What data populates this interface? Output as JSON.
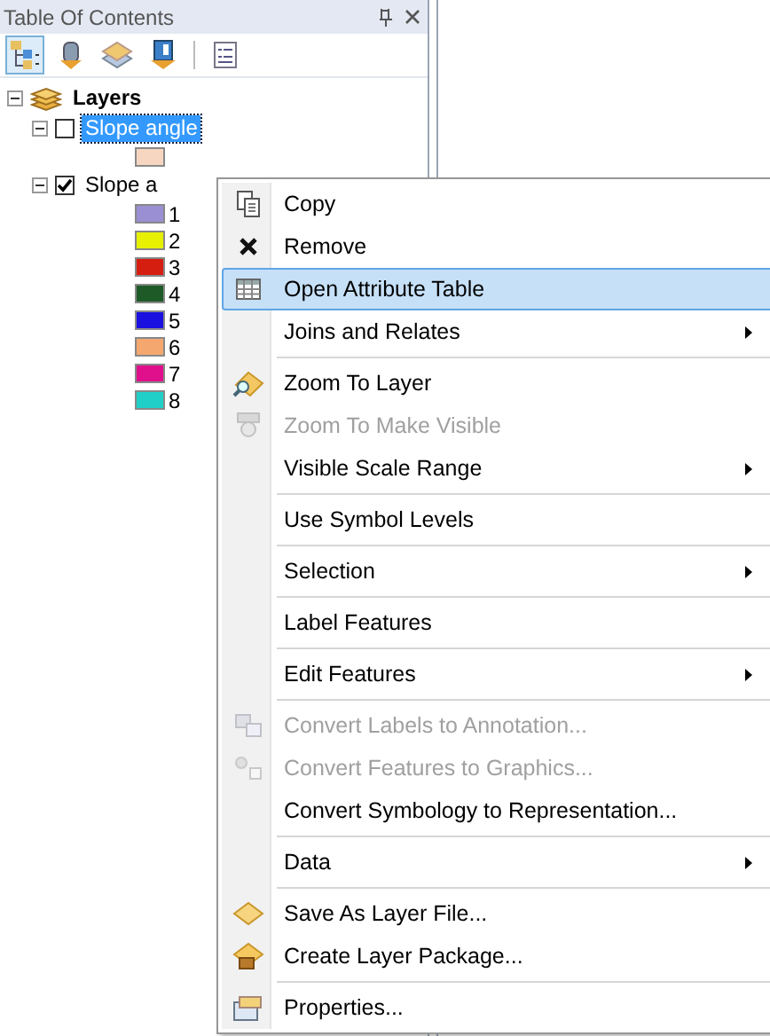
{
  "panel": {
    "title": "Table Of Contents"
  },
  "toolbar": [
    {
      "selected": true
    },
    {
      "selected": false
    },
    {
      "selected": false
    },
    {
      "selected": false
    },
    {
      "selected": false
    }
  ],
  "tree": {
    "label": "Layers",
    "expanded": true,
    "children": [
      {
        "label": "Slope angle",
        "checked": false,
        "selected": true,
        "expanded": true,
        "legend": [
          {
            "color": "#f6d6c0"
          }
        ]
      },
      {
        "label": "Slope a",
        "checked": true,
        "selected": false,
        "expanded": true,
        "legend": [
          {
            "label": "1",
            "color": "#9b8fd4"
          },
          {
            "label": "2",
            "color": "#e6f000"
          },
          {
            "label": "3",
            "color": "#d61e10"
          },
          {
            "label": "4",
            "color": "#1d5a28"
          },
          {
            "label": "5",
            "color": "#1a10e0"
          },
          {
            "label": "6",
            "color": "#f4a870"
          },
          {
            "label": "7",
            "color": "#e0108c"
          },
          {
            "label": "8",
            "color": "#20d0c8"
          }
        ]
      }
    ]
  },
  "context_menu": [
    {
      "label": "Copy",
      "disabled": false,
      "selected": false,
      "submenu": false,
      "divider_below": false
    },
    {
      "label": "Remove",
      "disabled": false,
      "selected": false,
      "submenu": false,
      "divider_below": false
    },
    {
      "label": "Open Attribute Table",
      "disabled": false,
      "selected": true,
      "submenu": false,
      "divider_below": false
    },
    {
      "label": "Joins and Relates",
      "disabled": false,
      "selected": false,
      "submenu": true,
      "divider_below": true
    },
    {
      "label": "Zoom To Layer",
      "disabled": false,
      "selected": false,
      "submenu": false,
      "divider_below": false
    },
    {
      "label": "Zoom To Make Visible",
      "disabled": true,
      "selected": false,
      "submenu": false,
      "divider_below": false
    },
    {
      "label": "Visible Scale Range",
      "disabled": false,
      "selected": false,
      "submenu": true,
      "divider_below": true
    },
    {
      "label": "Use Symbol Levels",
      "disabled": false,
      "selected": false,
      "submenu": false,
      "divider_below": true
    },
    {
      "label": "Selection",
      "disabled": false,
      "selected": false,
      "submenu": true,
      "divider_below": true
    },
    {
      "label": "Label Features",
      "disabled": false,
      "selected": false,
      "submenu": false,
      "divider_below": true
    },
    {
      "label": "Edit Features",
      "disabled": false,
      "selected": false,
      "submenu": true,
      "divider_below": true
    },
    {
      "label": "Convert Labels to Annotation...",
      "disabled": true,
      "selected": false,
      "submenu": false,
      "divider_below": false
    },
    {
      "label": "Convert Features to Graphics...",
      "disabled": true,
      "selected": false,
      "submenu": false,
      "divider_below": false
    },
    {
      "label": "Convert Symbology to Representation...",
      "disabled": false,
      "selected": false,
      "submenu": false,
      "divider_below": true
    },
    {
      "label": "Data",
      "disabled": false,
      "selected": false,
      "submenu": true,
      "divider_below": true
    },
    {
      "label": "Save As Layer File...",
      "disabled": false,
      "selected": false,
      "submenu": false,
      "divider_below": false
    },
    {
      "label": "Create Layer Package...",
      "disabled": false,
      "selected": false,
      "submenu": false,
      "divider_below": true
    },
    {
      "label": "Properties...",
      "disabled": false,
      "selected": false,
      "submenu": false,
      "divider_below": false
    }
  ]
}
